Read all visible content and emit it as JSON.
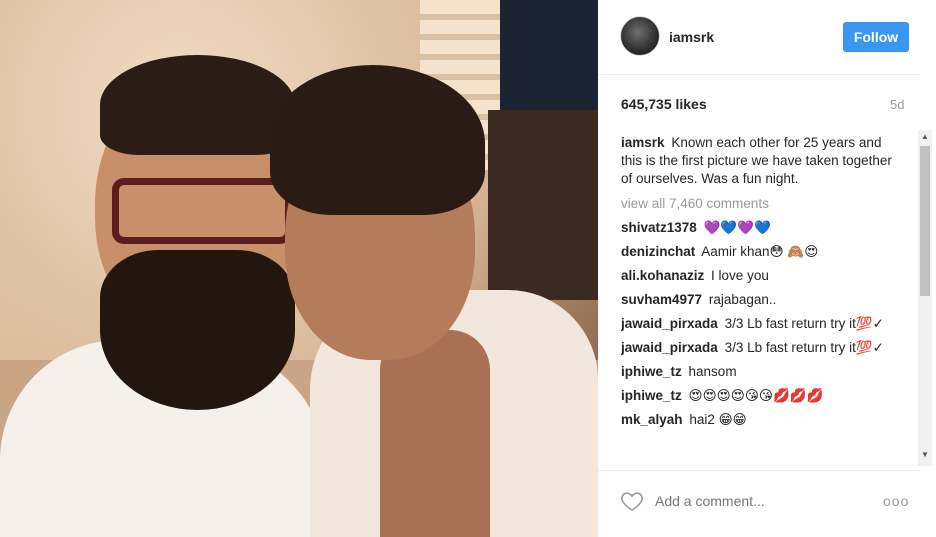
{
  "post": {
    "username": "iamsrk",
    "follow_label": "Follow",
    "likes": "645,735 likes",
    "age": "5d",
    "caption_user": "iamsrk",
    "caption_text": "Known each other for 25 years and this is the first picture we have taken together of ourselves. Was a fun night.",
    "view_all": "view all 7,460 comments",
    "comments": [
      {
        "user": "shivatz1378",
        "text": "💜💙💜💙"
      },
      {
        "user": "denizinchat",
        "text": "Aamir khan😳 🙈😍"
      },
      {
        "user": "ali.kohanaziz",
        "text": "I love you"
      },
      {
        "user": "suvham4977",
        "text": "rajabagan.."
      },
      {
        "user": "jawaid_pirxada",
        "text": "3/3 Lb fast return try it💯✓"
      },
      {
        "user": "jawaid_pirxada",
        "text": "3/3 Lb fast return try it💯✓"
      },
      {
        "user": "iphiwe_tz",
        "text": "hansom"
      },
      {
        "user": "iphiwe_tz",
        "text": "😍😍😍😍😘😘💋💋💋"
      },
      {
        "user": "mk_alyah",
        "text": "hai2 😁😁"
      }
    ],
    "add_comment_placeholder": "Add a comment...",
    "more_label": "ooo"
  },
  "colors": {
    "follow_bg": "#3897f0",
    "muted": "#999999"
  },
  "icons": {
    "like": "heart-outline-icon",
    "more": "more-options-icon",
    "avatar": "profile-avatar"
  }
}
